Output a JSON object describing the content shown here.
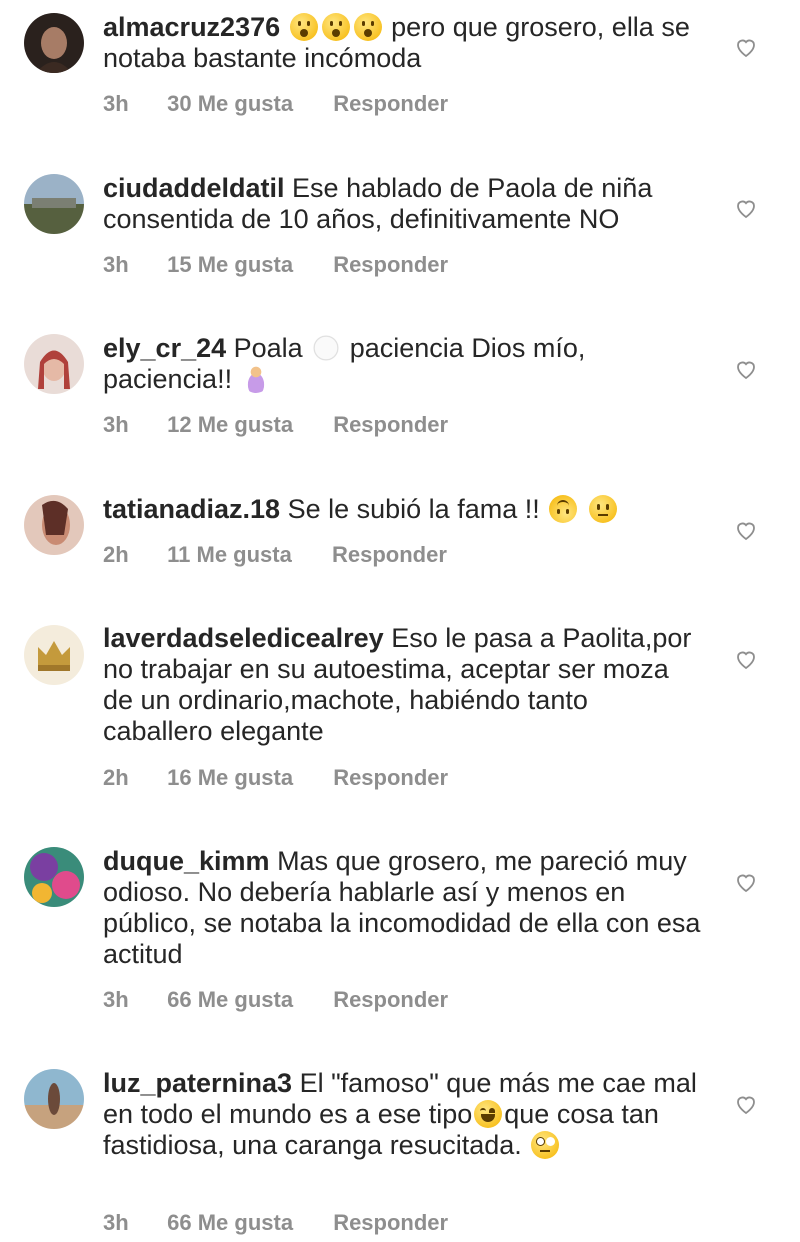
{
  "comments": [
    {
      "username": "almacruz2376",
      "text_parts": [
        "",
        "pero que grosero, ella se notaba bastante incómoda"
      ],
      "emojis_lead": [
        "wow",
        "wow",
        "wow"
      ],
      "time": "3h",
      "likes": "30 Me gusta",
      "reply": "Responder",
      "avatar_colors": [
        "#3b2a22",
        "#a77c66"
      ]
    },
    {
      "username": "ciudaddeldatil",
      "text": "Ese hablado de Paola de niña consentida de 10 años, definitivamente  NO",
      "time": "3h",
      "likes": "15 Me gusta",
      "reply": "Responder",
      "avatar_colors": [
        "#7f98b0",
        "#4f5a3e"
      ]
    },
    {
      "username": "ely_cr_24",
      "text_a": "Poala",
      "text_b": "paciencia Dios mío, paciencia!!",
      "time": "3h",
      "likes": "12 Me gusta",
      "reply": "Responder",
      "avatar_colors": [
        "#e7d3cf",
        "#b0413b"
      ]
    },
    {
      "username": "tatianadiaz.18",
      "text": "Se le subió la fama !!",
      "time": "2h",
      "likes": "11 Me gusta",
      "reply": "Responder",
      "avatar_colors": [
        "#c98b73",
        "#5d2f27"
      ]
    },
    {
      "username": "laverdadseledicealrey",
      "text": "Eso le pasa a Paolita,por no trabajar en su autoestima, aceptar ser moza de un ordinario,machote, habiéndo tanto caballero  elegante",
      "time": "2h",
      "likes": "16 Me gusta",
      "reply": "Responder",
      "avatar_colors": [
        "#f1e6d0",
        "#c49a3c"
      ]
    },
    {
      "username": "duque_kimm",
      "text": "Mas que grosero, me pareció muy odioso. No debería hablarle así y menos en público, se notaba la incomodidad de ella con esa actitud",
      "time": "3h",
      "likes": "66 Me gusta",
      "reply": "Responder",
      "avatar_colors": [
        "#7a3fa1",
        "#2f9a7e"
      ]
    },
    {
      "username": "luz_paternina3",
      "text_a": "El \"famoso\" que más me cae mal en todo el mundo es a ese tipo",
      "text_b": "que cosa tan fastidiosa, una caranga resucitada.",
      "time": "3h",
      "likes": "66 Me gusta",
      "reply": "Responder",
      "avatar_colors": [
        "#8fb7cf",
        "#c6a27e"
      ]
    }
  ],
  "icons": {
    "like": "heart-outline-icon"
  }
}
